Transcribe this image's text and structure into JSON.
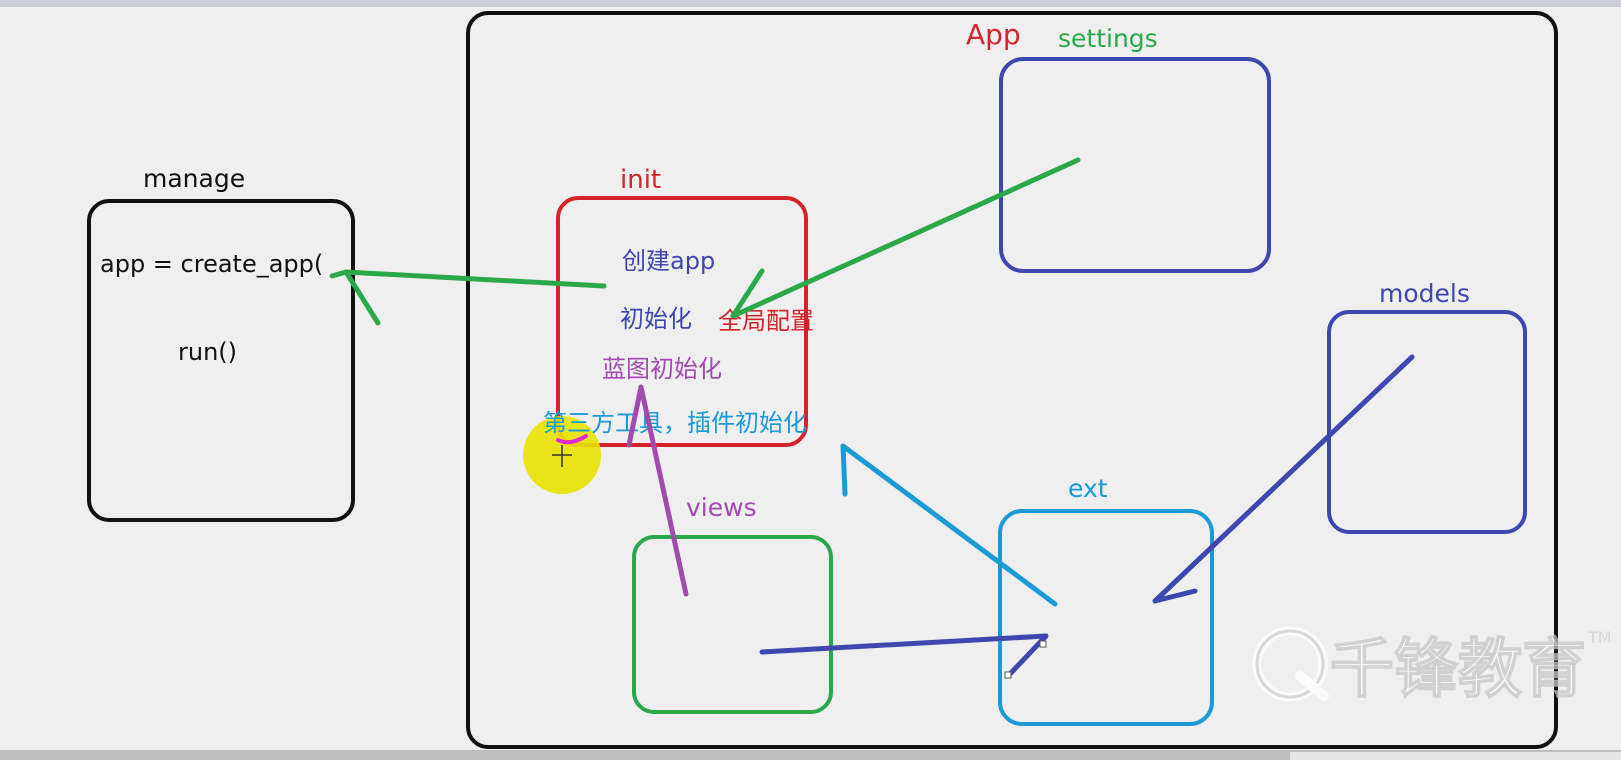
{
  "labels": {
    "app": "App",
    "settings": "settings",
    "manage": "manage",
    "init": "init",
    "models": "models",
    "ext": "ext",
    "views": "views"
  },
  "manage_box": {
    "line1": "app = create_app(",
    "line2": "run()"
  },
  "init_box": {
    "create_app": "创建app",
    "init": "初始化",
    "global_config": "全局配置",
    "blueprint_init": "蓝图初始化",
    "third_party_init": "第三方工具，插件初始化"
  },
  "watermark": {
    "text": "千锋教育",
    "tm": "TM"
  },
  "colors": {
    "background": "#efefef",
    "outline_black": "#111111",
    "red": "#d4232b",
    "green": "#2aa84a",
    "blue": "#3f46b0",
    "cyan": "#1a9ad6",
    "purple": "#a24ab0",
    "cursor_highlight": "#e8e200"
  }
}
